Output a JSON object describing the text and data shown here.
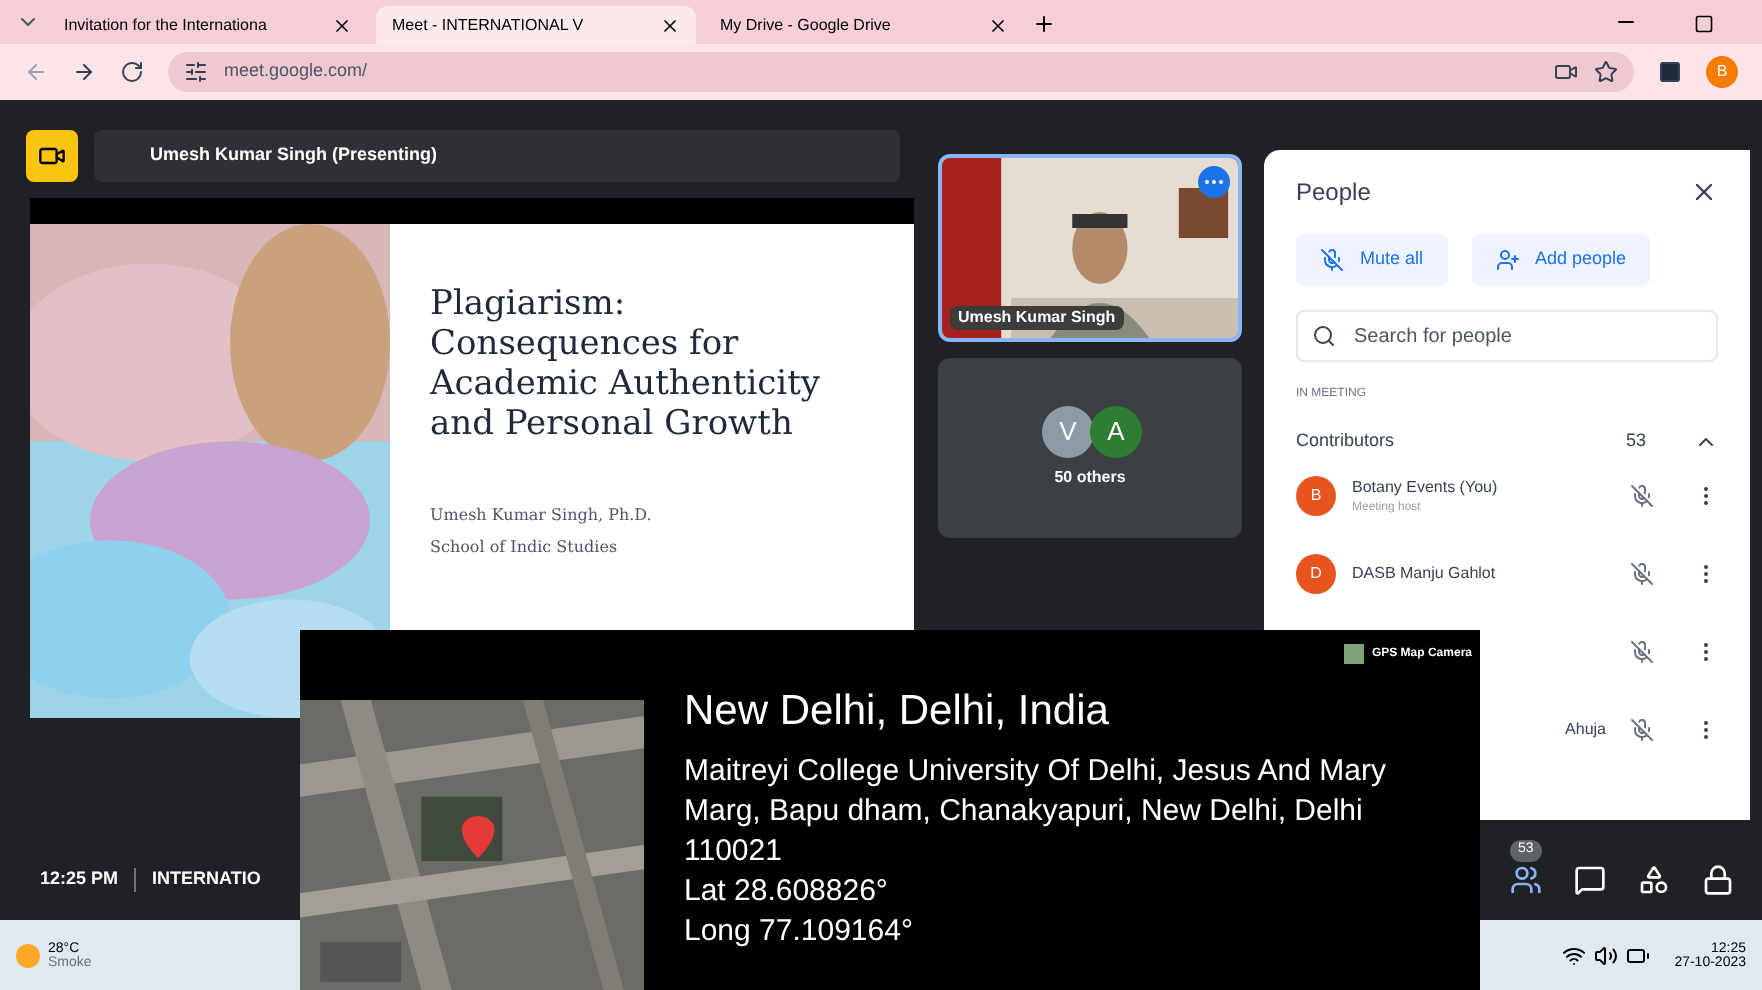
{
  "browser": {
    "tabs": [
      {
        "title": "Invitation for the Internationa",
        "selected": false
      },
      {
        "title": "Meet - INTERNATIONAL V",
        "selected": true
      },
      {
        "title": "My Drive - Google Drive",
        "selected": false
      }
    ],
    "url": "meet.google.com/",
    "profile": "B"
  },
  "meet": {
    "presenter_label": "Umesh Kumar Singh (Presenting)",
    "slide": {
      "title": "Plagiarism: Consequences for Academic Authenticity and Personal Growth",
      "author": "Umesh Kumar Singh, Ph.D.",
      "affiliation": "School of Indic Studies"
    },
    "tiles": [
      {
        "kind": "video",
        "name": "Umesh Kumar Singh"
      },
      {
        "kind": "others",
        "avatars": [
          {
            "letter": "V",
            "color": "#8d9ba6"
          },
          {
            "letter": "A",
            "color": "#2e7d32"
          }
        ],
        "label": "50 others"
      }
    ],
    "people": {
      "title": "People",
      "mute_all": "Mute all",
      "add_people": "Add people",
      "search_placeholder": "Search for people",
      "section": "IN MEETING",
      "group": "Contributors",
      "count": "53",
      "expanded": true,
      "members": [
        {
          "kind": "full",
          "initial": "B",
          "name": "Botany Events (You)",
          "role": "Meeting host"
        },
        {
          "kind": "full",
          "initial": "D",
          "name": "DASB Manju Gahlot"
        },
        {
          "kind": "covered"
        },
        {
          "kind": "partial",
          "name": "Ahuja"
        }
      ]
    },
    "time": "12:25 PM",
    "meeting_name": "INTERNATIO",
    "people_badge": "53"
  },
  "taskbar": {
    "temperature": "28°C",
    "weather": "Smoke",
    "clock": "12:25",
    "date": "27-10-2023"
  },
  "gps": {
    "app": "GPS Map Camera",
    "place": "New Delhi, Delhi, India",
    "address": "Maitreyi College University Of Delhi, Jesus And Mary Marg, Bapu dham, Chanakyapuri, New Delhi, Delhi 110021",
    "lat": "Lat 28.608826°",
    "long": "Long 77.109164°"
  }
}
